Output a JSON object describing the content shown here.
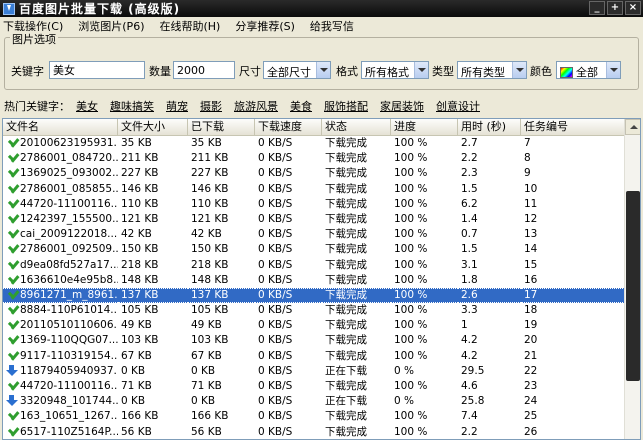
{
  "window": {
    "title": "百度图片批量下载 (高级版)"
  },
  "menu": [
    "下载操作(C)",
    "浏览图片(P6)",
    "在线帮助(H)",
    "分享推荐(S)",
    "给我写信"
  ],
  "options": {
    "legend": "图片选项",
    "keyword_label": "关键字",
    "keyword_value": "美女",
    "count_label": "数量",
    "count_value": "2000",
    "size_label": "尺寸",
    "size_value": "全部尺寸",
    "format_label": "格式",
    "format_value": "所有格式",
    "type_label": "类型",
    "type_value": "所有类型",
    "color_label": "颜色",
    "color_value": "全部"
  },
  "hotwords": {
    "label": "热门关键字：",
    "words": [
      "美女",
      "趣味搞笑",
      "萌宠",
      "摄影",
      "旅游风景",
      "美食",
      "服饰搭配",
      "家居装饰",
      "创意设计"
    ]
  },
  "table": {
    "columns": [
      "文件名",
      "文件大小",
      "已下载",
      "下载速度",
      "状态",
      "进度",
      "用时 (秒)",
      "任务编号"
    ],
    "rows": [
      {
        "name": "20100623195931...",
        "size": "35 KB",
        "downloaded": "35 KB",
        "speed": "0 KB/S",
        "status": "下载完成",
        "progress": "100 %",
        "time": "2.7",
        "id": "7",
        "icon": "done"
      },
      {
        "name": "2786001_084720...",
        "size": "211 KB",
        "downloaded": "211 KB",
        "speed": "0 KB/S",
        "status": "下载完成",
        "progress": "100 %",
        "time": "2.2",
        "id": "8",
        "icon": "done"
      },
      {
        "name": "1369025_093002...",
        "size": "227 KB",
        "downloaded": "227 KB",
        "speed": "0 KB/S",
        "status": "下载完成",
        "progress": "100 %",
        "time": "2.3",
        "id": "9",
        "icon": "done"
      },
      {
        "name": "2786001_085855...",
        "size": "146 KB",
        "downloaded": "146 KB",
        "speed": "0 KB/S",
        "status": "下载完成",
        "progress": "100 %",
        "time": "1.5",
        "id": "10",
        "icon": "done"
      },
      {
        "name": "44720-11100116...",
        "size": "110 KB",
        "downloaded": "110 KB",
        "speed": "0 KB/S",
        "status": "下载完成",
        "progress": "100 %",
        "time": "6.2",
        "id": "11",
        "icon": "done"
      },
      {
        "name": "1242397_155500...",
        "size": "121 KB",
        "downloaded": "121 KB",
        "speed": "0 KB/S",
        "status": "下载完成",
        "progress": "100 %",
        "time": "1.4",
        "id": "12",
        "icon": "done"
      },
      {
        "name": "cai_2009122018...",
        "size": "42 KB",
        "downloaded": "42 KB",
        "speed": "0 KB/S",
        "status": "下载完成",
        "progress": "100 %",
        "time": "0.7",
        "id": "13",
        "icon": "done"
      },
      {
        "name": "2786001_092509...",
        "size": "150 KB",
        "downloaded": "150 KB",
        "speed": "0 KB/S",
        "status": "下载完成",
        "progress": "100 %",
        "time": "1.5",
        "id": "14",
        "icon": "done"
      },
      {
        "name": "d9ea08fd527a17...",
        "size": "218 KB",
        "downloaded": "218 KB",
        "speed": "0 KB/S",
        "status": "下载完成",
        "progress": "100 %",
        "time": "3.1",
        "id": "15",
        "icon": "done"
      },
      {
        "name": "1636610e4e95b8...",
        "size": "148 KB",
        "downloaded": "148 KB",
        "speed": "0 KB/S",
        "status": "下载完成",
        "progress": "100 %",
        "time": "1.8",
        "id": "16",
        "icon": "done"
      },
      {
        "name": "8961271_m_8961...",
        "size": "137 KB",
        "downloaded": "137 KB",
        "speed": "0 KB/S",
        "status": "下载完成",
        "progress": "100 %",
        "time": "2.6",
        "id": "17",
        "icon": "done",
        "selected": true
      },
      {
        "name": "8884-110P61014...",
        "size": "105 KB",
        "downloaded": "105 KB",
        "speed": "0 KB/S",
        "status": "下载完成",
        "progress": "100 %",
        "time": "3.3",
        "id": "18",
        "icon": "done"
      },
      {
        "name": "20110510110606...",
        "size": "49 KB",
        "downloaded": "49 KB",
        "speed": "0 KB/S",
        "status": "下载完成",
        "progress": "100 %",
        "time": "1",
        "id": "19",
        "icon": "done"
      },
      {
        "name": "1369-110QQG07...",
        "size": "103 KB",
        "downloaded": "103 KB",
        "speed": "0 KB/S",
        "status": "下载完成",
        "progress": "100 %",
        "time": "4.2",
        "id": "20",
        "icon": "done"
      },
      {
        "name": "9117-110319154...",
        "size": "67 KB",
        "downloaded": "67 KB",
        "speed": "0 KB/S",
        "status": "下载完成",
        "progress": "100 %",
        "time": "4.2",
        "id": "21",
        "icon": "done"
      },
      {
        "name": "11879405940937...",
        "size": "0 KB",
        "downloaded": "0 KB",
        "speed": "0 KB/S",
        "status": "正在下载",
        "progress": "0 %",
        "time": "29.5",
        "id": "22",
        "icon": "downloading"
      },
      {
        "name": "44720-11100116...",
        "size": "71 KB",
        "downloaded": "71 KB",
        "speed": "0 KB/S",
        "status": "下载完成",
        "progress": "100 %",
        "time": "4.6",
        "id": "23",
        "icon": "done"
      },
      {
        "name": "3320948_101744...",
        "size": "0 KB",
        "downloaded": "0 KB",
        "speed": "0 KB/S",
        "status": "正在下载",
        "progress": "0 %",
        "time": "25.8",
        "id": "24",
        "icon": "downloading"
      },
      {
        "name": "163_10651_1267...",
        "size": "166 KB",
        "downloaded": "166 KB",
        "speed": "0 KB/S",
        "status": "下载完成",
        "progress": "100 %",
        "time": "7.4",
        "id": "25",
        "icon": "done"
      },
      {
        "name": "6517-110Z5164P...",
        "size": "56 KB",
        "downloaded": "56 KB",
        "speed": "0 KB/S",
        "status": "下载完成",
        "progress": "100 %",
        "time": "2.2",
        "id": "26",
        "icon": "done"
      }
    ]
  }
}
